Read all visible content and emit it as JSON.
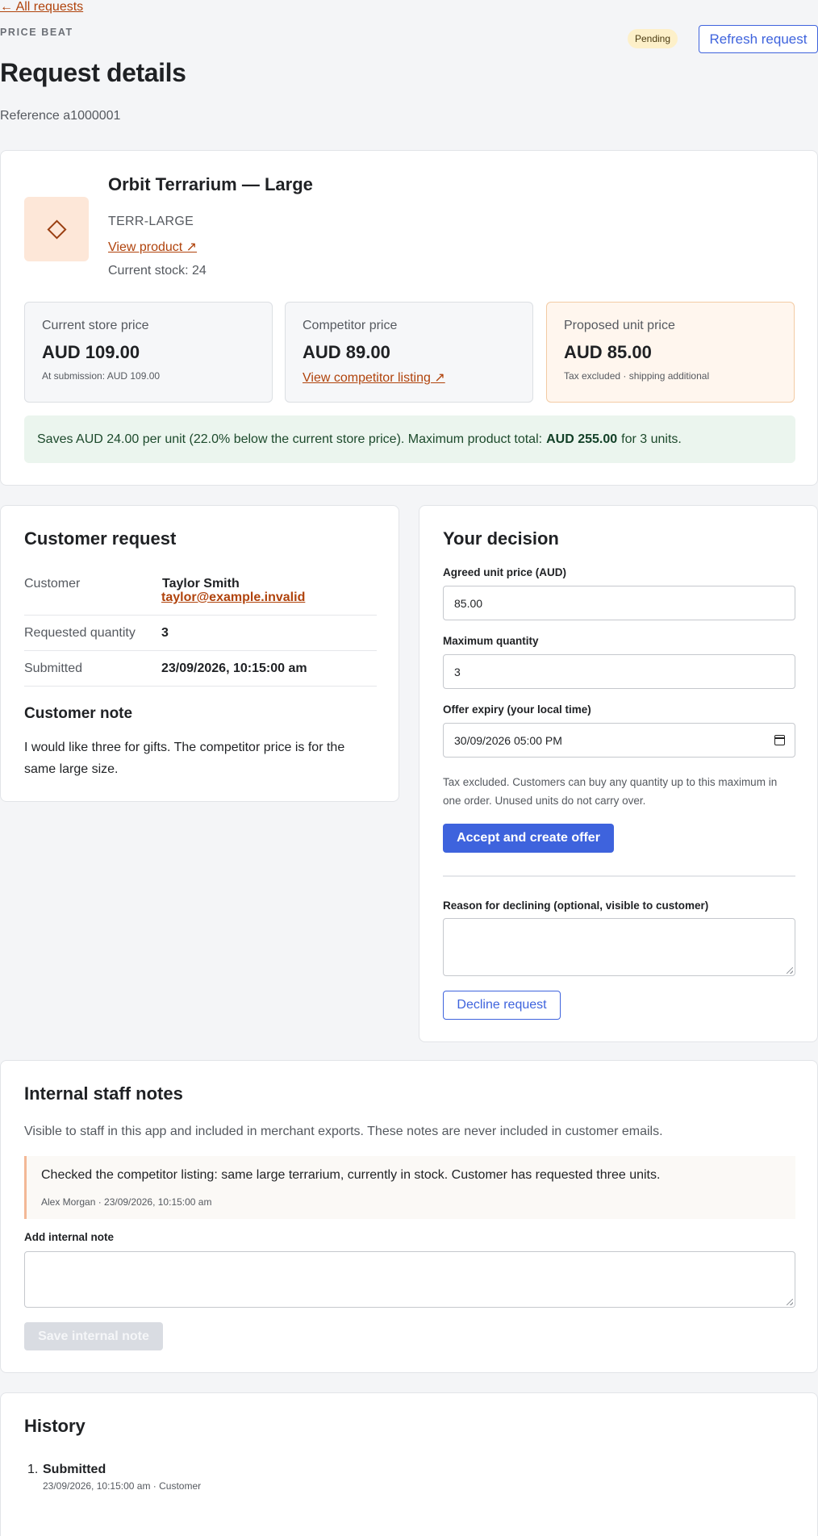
{
  "header": {
    "back_link": "← All requests",
    "eyebrow": "PRICE BEAT",
    "status": "Pending",
    "refresh_label": "Refresh request",
    "title": "Request details",
    "reference": "Reference a1000001"
  },
  "product": {
    "name": "Orbit Terrarium — Large",
    "sku": "TERR-LARGE",
    "view_link": "View product ↗",
    "stock": "Current stock: 24",
    "prices": {
      "store": {
        "label": "Current store price",
        "value": "AUD 109.00",
        "sub": "At submission: AUD 109.00"
      },
      "competitor": {
        "label": "Competitor price",
        "value": "AUD 89.00",
        "link": "View competitor listing ↗"
      },
      "proposed": {
        "label": "Proposed unit price",
        "value": "AUD 85.00",
        "sub": "Tax excluded · shipping additional"
      }
    },
    "savings": {
      "text_before": "Saves AUD 24.00 per unit (22.0% below the current store price). Maximum product total:",
      "total": "AUD 255.00",
      "text_after": "for 3 units."
    }
  },
  "customer_request": {
    "title": "Customer request",
    "rows": [
      {
        "label": "Customer",
        "name": "Taylor Smith",
        "email": "taylor@example.invalid"
      },
      {
        "label": "Requested quantity",
        "value": "3"
      },
      {
        "label": "Submitted",
        "value": "23/09/2026, 10:15:00 am"
      }
    ],
    "note_title": "Customer note",
    "note": "I would like three for gifts. The competitor price is for the same large size."
  },
  "decision": {
    "title": "Your decision",
    "price_label": "Agreed unit price (AUD)",
    "price_value": "85.00",
    "quantity_label": "Maximum quantity",
    "quantity_value": "3",
    "expiry_label": "Offer expiry (your local time)",
    "expiry_value": "30/09/2026 05:00 PM",
    "help": "Tax excluded. Customers can buy any quantity up to this maximum in one order. Unused units do not carry over.",
    "accept_label": "Accept and create offer",
    "decline_reason_label": "Reason for declining (optional, visible to customer)",
    "decline_label": "Decline request"
  },
  "notes": {
    "title": "Internal staff notes",
    "description": "Visible to staff in this app and included in merchant exports. These notes are never included in customer emails.",
    "entries": [
      {
        "text": "Checked the competitor listing: same large terrarium, currently in stock. Customer has requested three units.",
        "meta": "Alex Morgan · 23/09/2026, 10:15:00 am"
      }
    ],
    "add_label": "Add internal note",
    "save_label": "Save internal note"
  },
  "history": {
    "title": "History",
    "events": [
      {
        "number": "1.",
        "event": "Submitted",
        "meta": "23/09/2026, 10:15:00 am · Customer"
      }
    ]
  },
  "colors": {
    "accent": "#3e63dd",
    "link": "#b0430c",
    "pending_badge": "#fdf0c9",
    "savings_bg": "#ebf5ee"
  }
}
